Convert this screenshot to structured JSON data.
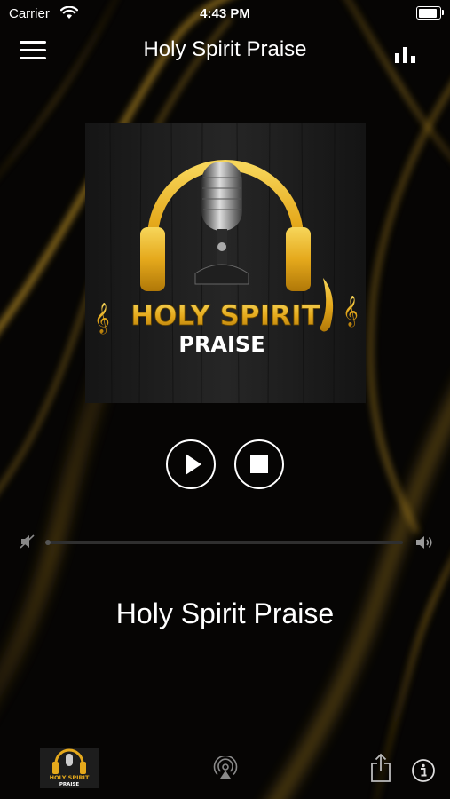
{
  "status_bar": {
    "carrier": "Carrier",
    "time": "4:43 PM",
    "battery_level": 1.0
  },
  "nav": {
    "title": "Holy Spirit Praise",
    "menu_icon": "hamburger-menu-icon",
    "equalizer_icon": "equalizer-icon"
  },
  "artwork": {
    "line1": "HOLY SPIRIT",
    "line2": "PRAISE"
  },
  "controls": {
    "play_icon": "play-icon",
    "stop_icon": "stop-icon"
  },
  "volume": {
    "level": 0.0,
    "min_icon": "volume-mute-icon",
    "max_icon": "volume-high-icon"
  },
  "now_playing": {
    "title": "Holy Spirit Praise"
  },
  "bottom_bar": {
    "mini_line1": "HOLY SPIRIT",
    "mini_line2": "PRAISE",
    "airplay_icon": "airplay-icon",
    "share_icon": "share-icon",
    "info_icon": "info-icon"
  },
  "colors": {
    "accent_gold": "#e8b422",
    "background": "#050403",
    "wood": "#1c1c1c"
  }
}
